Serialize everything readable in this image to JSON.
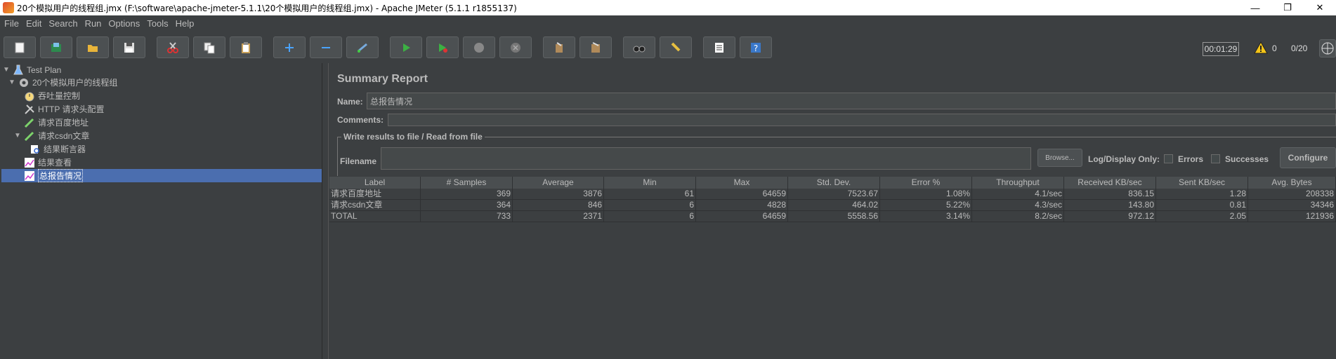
{
  "window": {
    "title": "20个模拟用户的线程组.jmx (F:\\software\\apache-jmeter-5.1.1\\20个模拟用户的线程组.jmx) - Apache JMeter (5.1.1 r1855137)",
    "minimize": "—",
    "restore": "❐",
    "close": "✕"
  },
  "menu": [
    "File",
    "Edit",
    "Search",
    "Run",
    "Options",
    "Tools",
    "Help"
  ],
  "status": {
    "elapsed": "00:01:29",
    "warnings": "0",
    "threads": "0/20"
  },
  "tree": [
    {
      "label": "Test Plan",
      "icon": "flask-icon",
      "arrow": "▼"
    },
    {
      "label": "20个模拟用户的线程组",
      "icon": "gear-icon",
      "arrow": "▼"
    },
    {
      "label": "吞吐量控制",
      "icon": "stopwatch-icon",
      "arrow": ""
    },
    {
      "label": "HTTP 请求头配置",
      "icon": "wrench-icon",
      "arrow": ""
    },
    {
      "label": "请求百度地址",
      "icon": "pipette-icon",
      "arrow": ""
    },
    {
      "label": "请求csdn文章",
      "icon": "pipette-icon",
      "arrow": "▼"
    },
    {
      "label": "结果断言器",
      "icon": "magnifier-icon",
      "arrow": ""
    },
    {
      "label": "结果查看",
      "icon": "chart-icon",
      "arrow": ""
    },
    {
      "label": "总报告情况",
      "icon": "chart-icon",
      "arrow": ""
    }
  ],
  "report": {
    "title": "Summary Report",
    "name_label": "Name:",
    "name_value": "总报告情况",
    "comments_label": "Comments:",
    "write_results_legend": "Write results to file / Read from file",
    "filename_label": "Filename",
    "browse_label": "Browse...",
    "log_display_label": "Log/Display Only:",
    "errors_label": "Errors",
    "successes_label": "Successes",
    "configure_label": "Configure"
  },
  "table": {
    "columns": [
      "Label",
      "# Samples",
      "Average",
      "Min",
      "Max",
      "Std. Dev.",
      "Error %",
      "Throughput",
      "Received KB/sec",
      "Sent KB/sec",
      "Avg. Bytes"
    ],
    "rows": [
      [
        "请求百度地址",
        "369",
        "3876",
        "61",
        "64659",
        "7523.67",
        "1.08%",
        "4.1/sec",
        "836.15",
        "1.28",
        "208338"
      ],
      [
        "请求csdn文章",
        "364",
        "846",
        "6",
        "4828",
        "464.02",
        "5.22%",
        "4.3/sec",
        "143.80",
        "0.81",
        "34346"
      ],
      [
        "TOTAL",
        "733",
        "2371",
        "6",
        "64659",
        "5558.56",
        "3.14%",
        "8.2/sec",
        "972.12",
        "2.05",
        "121936"
      ]
    ]
  }
}
